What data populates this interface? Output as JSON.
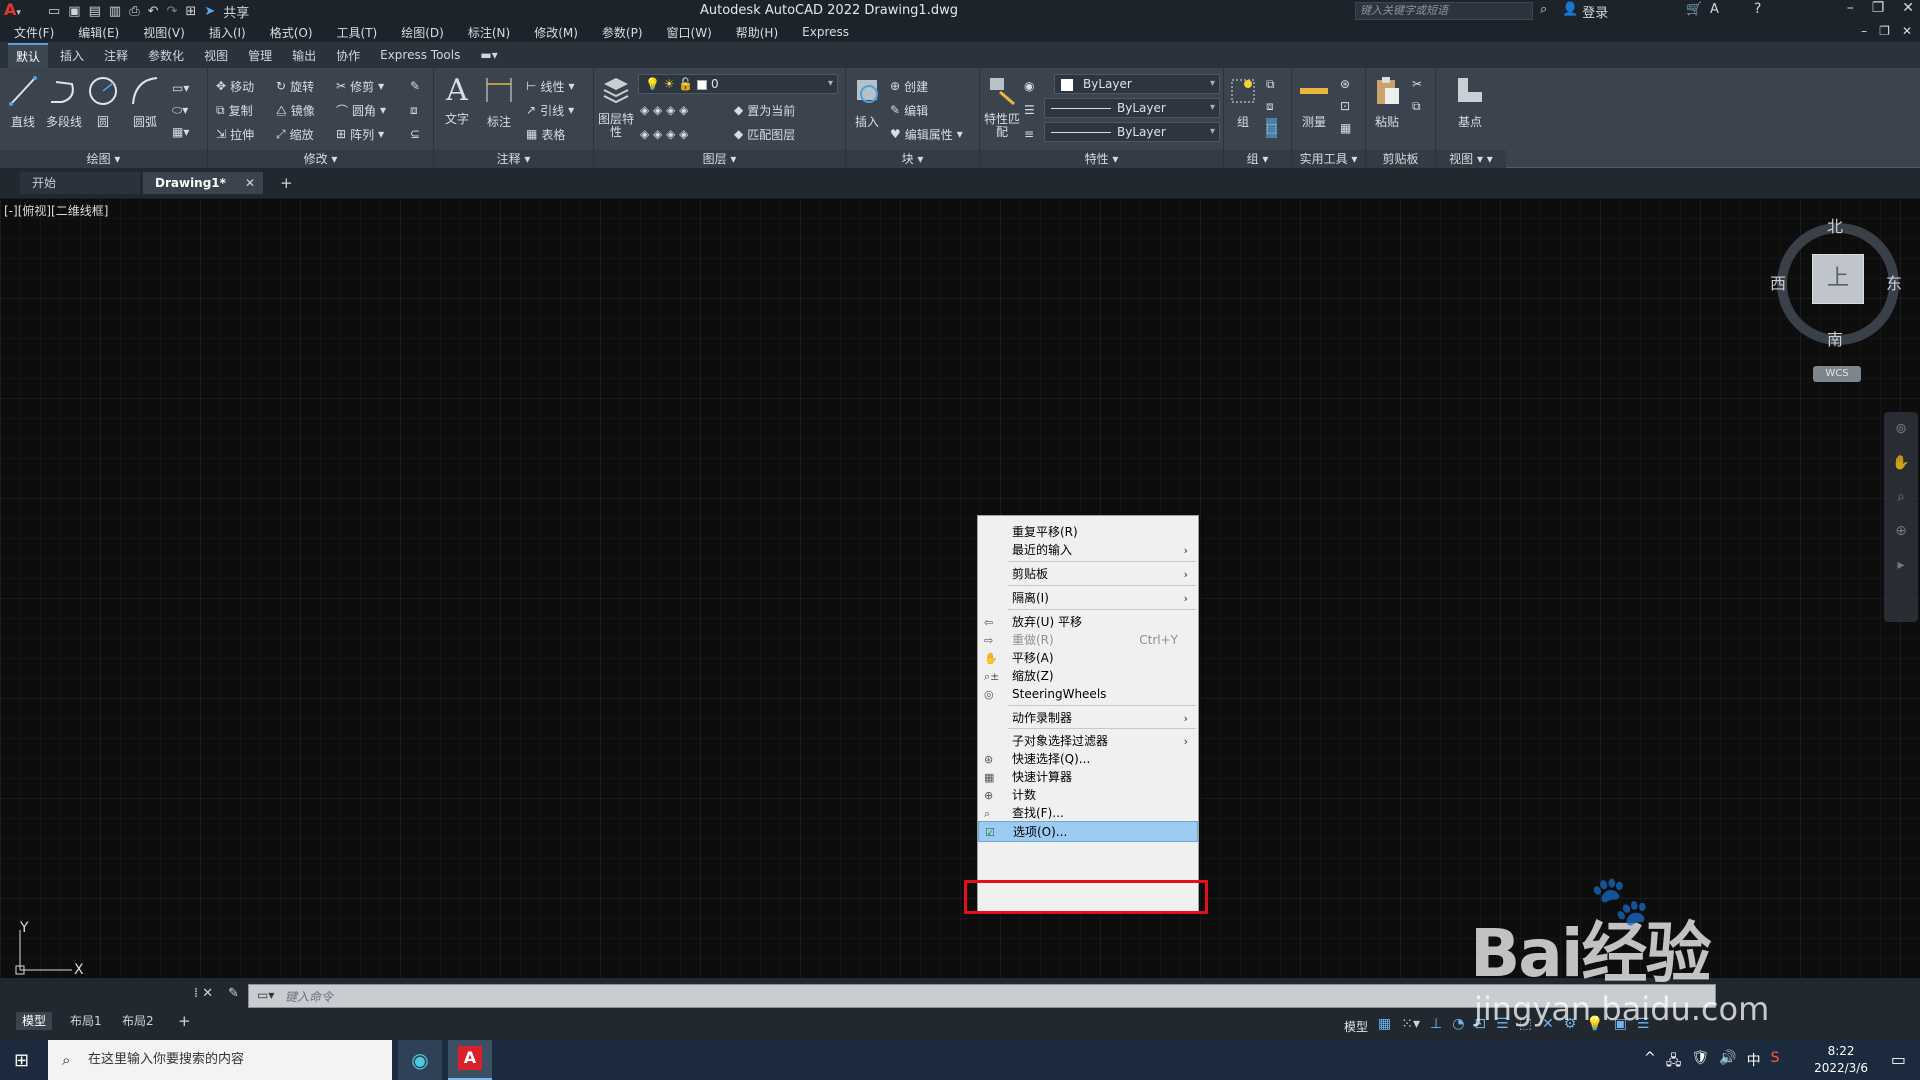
{
  "window": {
    "title": "Autodesk AutoCAD 2022    Drawing1.dwg",
    "share_label": "共享",
    "search_placeholder": "键入关键字或短语",
    "login_label": "登录"
  },
  "menubar": {
    "items": [
      "文件(F)",
      "编辑(E)",
      "视图(V)",
      "插入(I)",
      "格式(O)",
      "工具(T)",
      "绘图(D)",
      "标注(N)",
      "修改(M)",
      "参数(P)",
      "窗口(W)",
      "帮助(H)",
      "Express"
    ]
  },
  "ribbon_tabs": [
    "默认",
    "插入",
    "注释",
    "参数化",
    "视图",
    "管理",
    "输出",
    "协作",
    "Express Tools"
  ],
  "ribbon": {
    "draw": {
      "title": "绘图",
      "tools": [
        "直线",
        "多段线",
        "圆",
        "圆弧"
      ]
    },
    "modify": {
      "title": "修改",
      "tools": [
        "移动",
        "旋转",
        "修剪",
        "复制",
        "镜像",
        "圆角",
        "拉伸",
        "缩放",
        "阵列"
      ]
    },
    "annotation": {
      "title": "注释",
      "tools": [
        "文字",
        "标注",
        "线性",
        "引线",
        "表格"
      ]
    },
    "layers": {
      "title": "图层",
      "layer_props": "图层特性",
      "layer_name": "0",
      "set_current": "置为当前",
      "match_layer": "匹配图层"
    },
    "block": {
      "title": "块",
      "insert": "插入",
      "create": "创建",
      "edit": "编辑",
      "edit_attr": "编辑属性"
    },
    "properties": {
      "title": "特性",
      "match": "特性匹配",
      "color": "ByLayer",
      "linetype": "ByLayer",
      "lineweight": "ByLayer"
    },
    "groups": {
      "title": "组",
      "group": "组"
    },
    "utilities": {
      "title": "实用工具",
      "measure": "测量"
    },
    "clipboard": {
      "title": "剪贴板",
      "paste": "粘贴"
    },
    "view": {
      "title": "视图",
      "base": "基点"
    }
  },
  "file_tabs": {
    "start": "开始",
    "drawing": "Drawing1*"
  },
  "viewport": {
    "label": "[-][俯视][二维线框]",
    "viewcube": {
      "north": "北",
      "south": "南",
      "east": "东",
      "west": "西",
      "top": "上",
      "wcs": "WCS"
    },
    "ucs": {
      "x": "X",
      "y": "Y"
    }
  },
  "context_menu": {
    "items": [
      {
        "label": "重复平移(R)"
      },
      {
        "label": "最近的输入",
        "submenu": true
      },
      {
        "label": "剪贴板",
        "submenu": true
      },
      {
        "label": "隔离(I)",
        "submenu": true
      },
      {
        "label": "放弃(U) 平移",
        "icon": "undo-icon"
      },
      {
        "label": "重做(R)",
        "shortcut": "Ctrl+Y",
        "disabled": true,
        "icon": "redo-icon"
      },
      {
        "label": "平移(A)",
        "icon": "pan-hand-icon"
      },
      {
        "label": "缩放(Z)",
        "icon": "zoom-icon"
      },
      {
        "label": "SteeringWheels",
        "icon": "steering-wheel-icon"
      },
      {
        "label": "动作录制器",
        "submenu": true
      },
      {
        "label": "子对象选择过滤器",
        "submenu": true
      },
      {
        "label": "快速选择(Q)...",
        "icon": "quick-select-icon"
      },
      {
        "label": "快速计算器",
        "icon": "calculator-icon"
      },
      {
        "label": "计数",
        "icon": "count-icon"
      },
      {
        "label": "查找(F)...",
        "icon": "find-icon"
      },
      {
        "label": "选项(O)...",
        "icon": "options-check-icon",
        "selected": true
      }
    ]
  },
  "command_line": {
    "placeholder": "键入命令"
  },
  "layout_tabs": [
    "模型",
    "布局1",
    "布局2"
  ],
  "status": {
    "model": "模型"
  },
  "taskbar": {
    "search_placeholder": "在这里输入你要搜索的内容",
    "time": "8:22",
    "date": "2022/3/6",
    "ime": "中"
  },
  "watermark": {
    "brand": "Bai经验",
    "url": "jingyan.baidu.com"
  },
  "colors": {
    "highlight": "#e3101b",
    "menu_selected": "#9ccaf0",
    "canvas": "#0d0d0d"
  }
}
